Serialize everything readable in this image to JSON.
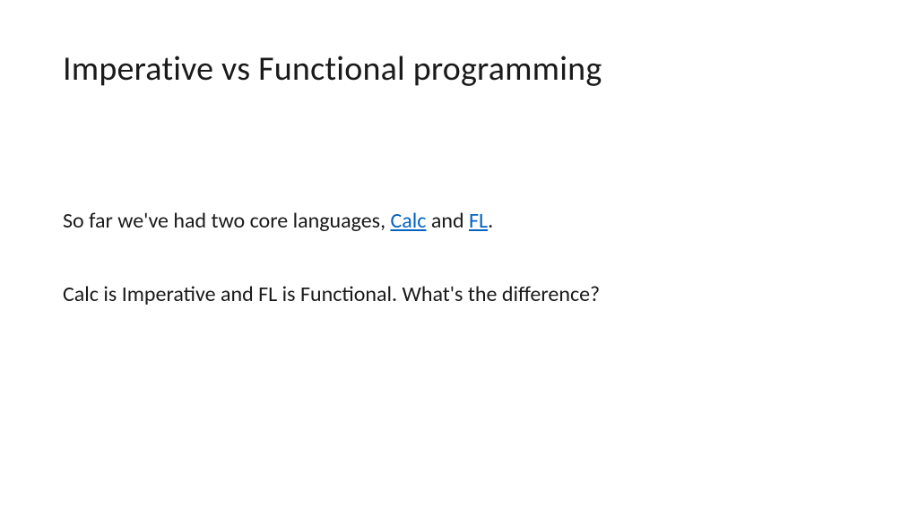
{
  "title": "Imperative vs Functional programming",
  "paragraph1": {
    "prefix": "So far we've had two core languages, ",
    "link1": "Calc",
    "mid": " and ",
    "link2": "FL",
    "suffix": "."
  },
  "paragraph2": "Calc is Imperative and FL is Functional. What's the difference?"
}
